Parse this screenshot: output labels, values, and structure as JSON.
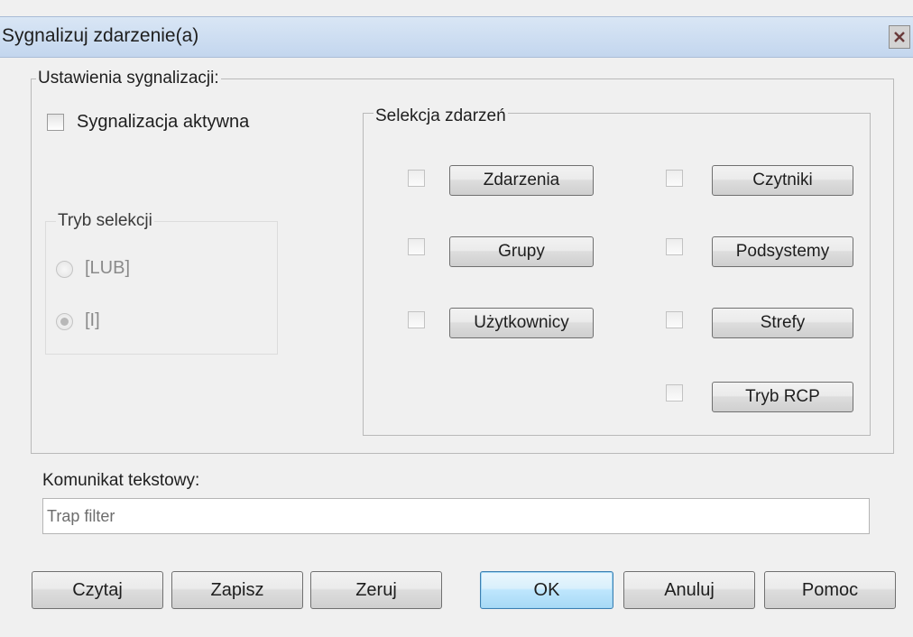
{
  "window": {
    "title": "Sygnalizuj zdarzenie(a)"
  },
  "settings": {
    "legend": "Ustawienia sygnalizacji:",
    "active_checkbox": {
      "label": "Sygnalizacja aktywna",
      "checked": false
    }
  },
  "selection_mode": {
    "legend": "Tryb selekcji",
    "options": [
      {
        "label": "[LUB]",
        "selected": false,
        "enabled": false
      },
      {
        "label": "[I]",
        "selected": true,
        "enabled": false
      }
    ]
  },
  "event_selection": {
    "legend": "Selekcja zdarzeń",
    "left": [
      {
        "label": "Zdarzenia",
        "checked": false
      },
      {
        "label": "Grupy",
        "checked": false
      },
      {
        "label": "Użytkownicy",
        "checked": false
      }
    ],
    "right": [
      {
        "label": "Czytniki",
        "checked": false
      },
      {
        "label": "Podsystemy",
        "checked": false
      },
      {
        "label": "Strefy",
        "checked": false
      },
      {
        "label": "Tryb RCP",
        "checked": false
      }
    ]
  },
  "message": {
    "label": "Komunikat tekstowy:",
    "value": "Trap filter"
  },
  "buttons": {
    "read": "Czytaj",
    "save": "Zapisz",
    "reset": "Zeruj",
    "ok": "OK",
    "cancel": "Anuluj",
    "help": "Pomoc"
  }
}
